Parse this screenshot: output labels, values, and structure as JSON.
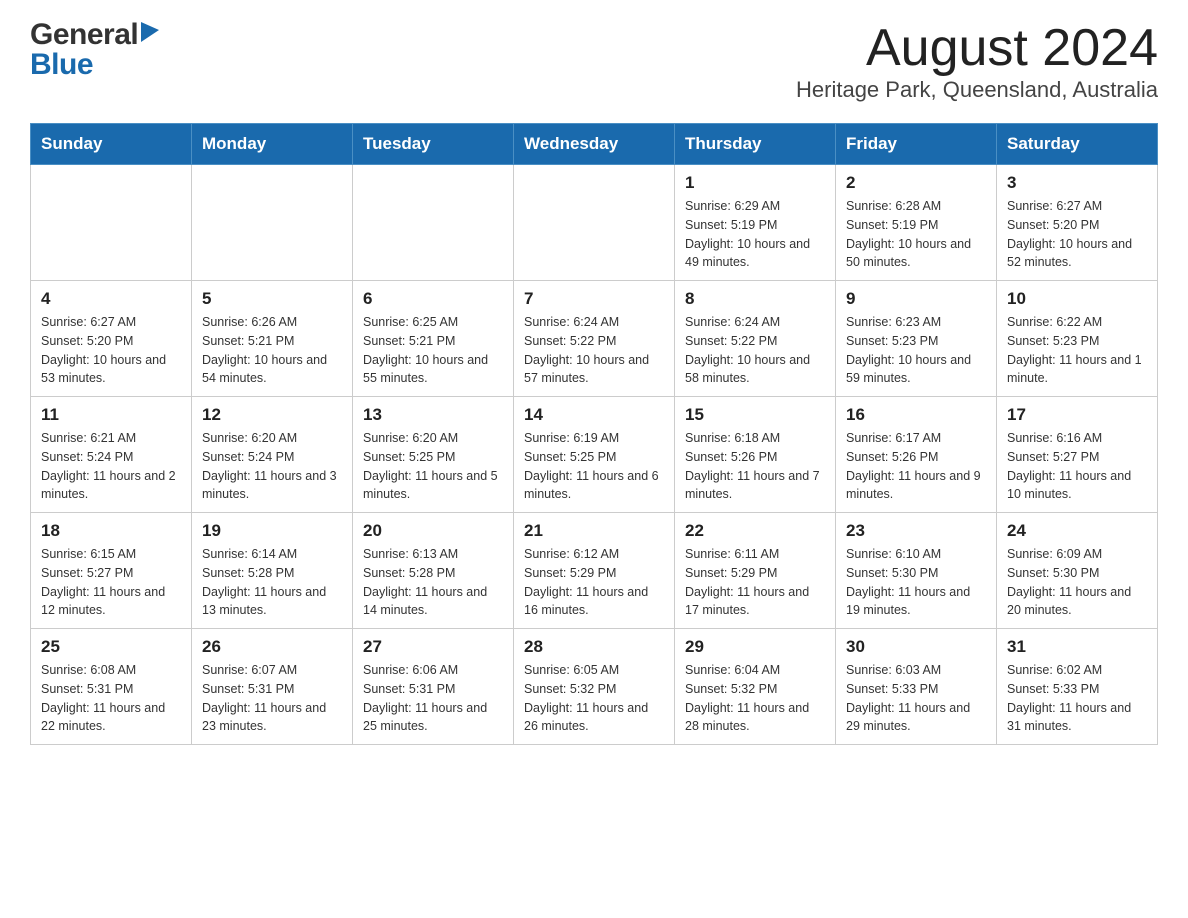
{
  "header": {
    "logo_general": "General",
    "logo_blue": "Blue",
    "month_title": "August 2024",
    "location": "Heritage Park, Queensland, Australia"
  },
  "weekdays": [
    "Sunday",
    "Monday",
    "Tuesday",
    "Wednesday",
    "Thursday",
    "Friday",
    "Saturday"
  ],
  "weeks": [
    [
      {
        "day": "",
        "info": ""
      },
      {
        "day": "",
        "info": ""
      },
      {
        "day": "",
        "info": ""
      },
      {
        "day": "",
        "info": ""
      },
      {
        "day": "1",
        "info": "Sunrise: 6:29 AM\nSunset: 5:19 PM\nDaylight: 10 hours\nand 49 minutes."
      },
      {
        "day": "2",
        "info": "Sunrise: 6:28 AM\nSunset: 5:19 PM\nDaylight: 10 hours\nand 50 minutes."
      },
      {
        "day": "3",
        "info": "Sunrise: 6:27 AM\nSunset: 5:20 PM\nDaylight: 10 hours\nand 52 minutes."
      }
    ],
    [
      {
        "day": "4",
        "info": "Sunrise: 6:27 AM\nSunset: 5:20 PM\nDaylight: 10 hours\nand 53 minutes."
      },
      {
        "day": "5",
        "info": "Sunrise: 6:26 AM\nSunset: 5:21 PM\nDaylight: 10 hours\nand 54 minutes."
      },
      {
        "day": "6",
        "info": "Sunrise: 6:25 AM\nSunset: 5:21 PM\nDaylight: 10 hours\nand 55 minutes."
      },
      {
        "day": "7",
        "info": "Sunrise: 6:24 AM\nSunset: 5:22 PM\nDaylight: 10 hours\nand 57 minutes."
      },
      {
        "day": "8",
        "info": "Sunrise: 6:24 AM\nSunset: 5:22 PM\nDaylight: 10 hours\nand 58 minutes."
      },
      {
        "day": "9",
        "info": "Sunrise: 6:23 AM\nSunset: 5:23 PM\nDaylight: 10 hours\nand 59 minutes."
      },
      {
        "day": "10",
        "info": "Sunrise: 6:22 AM\nSunset: 5:23 PM\nDaylight: 11 hours\nand 1 minute."
      }
    ],
    [
      {
        "day": "11",
        "info": "Sunrise: 6:21 AM\nSunset: 5:24 PM\nDaylight: 11 hours\nand 2 minutes."
      },
      {
        "day": "12",
        "info": "Sunrise: 6:20 AM\nSunset: 5:24 PM\nDaylight: 11 hours\nand 3 minutes."
      },
      {
        "day": "13",
        "info": "Sunrise: 6:20 AM\nSunset: 5:25 PM\nDaylight: 11 hours\nand 5 minutes."
      },
      {
        "day": "14",
        "info": "Sunrise: 6:19 AM\nSunset: 5:25 PM\nDaylight: 11 hours\nand 6 minutes."
      },
      {
        "day": "15",
        "info": "Sunrise: 6:18 AM\nSunset: 5:26 PM\nDaylight: 11 hours\nand 7 minutes."
      },
      {
        "day": "16",
        "info": "Sunrise: 6:17 AM\nSunset: 5:26 PM\nDaylight: 11 hours\nand 9 minutes."
      },
      {
        "day": "17",
        "info": "Sunrise: 6:16 AM\nSunset: 5:27 PM\nDaylight: 11 hours\nand 10 minutes."
      }
    ],
    [
      {
        "day": "18",
        "info": "Sunrise: 6:15 AM\nSunset: 5:27 PM\nDaylight: 11 hours\nand 12 minutes."
      },
      {
        "day": "19",
        "info": "Sunrise: 6:14 AM\nSunset: 5:28 PM\nDaylight: 11 hours\nand 13 minutes."
      },
      {
        "day": "20",
        "info": "Sunrise: 6:13 AM\nSunset: 5:28 PM\nDaylight: 11 hours\nand 14 minutes."
      },
      {
        "day": "21",
        "info": "Sunrise: 6:12 AM\nSunset: 5:29 PM\nDaylight: 11 hours\nand 16 minutes."
      },
      {
        "day": "22",
        "info": "Sunrise: 6:11 AM\nSunset: 5:29 PM\nDaylight: 11 hours\nand 17 minutes."
      },
      {
        "day": "23",
        "info": "Sunrise: 6:10 AM\nSunset: 5:30 PM\nDaylight: 11 hours\nand 19 minutes."
      },
      {
        "day": "24",
        "info": "Sunrise: 6:09 AM\nSunset: 5:30 PM\nDaylight: 11 hours\nand 20 minutes."
      }
    ],
    [
      {
        "day": "25",
        "info": "Sunrise: 6:08 AM\nSunset: 5:31 PM\nDaylight: 11 hours\nand 22 minutes."
      },
      {
        "day": "26",
        "info": "Sunrise: 6:07 AM\nSunset: 5:31 PM\nDaylight: 11 hours\nand 23 minutes."
      },
      {
        "day": "27",
        "info": "Sunrise: 6:06 AM\nSunset: 5:31 PM\nDaylight: 11 hours\nand 25 minutes."
      },
      {
        "day": "28",
        "info": "Sunrise: 6:05 AM\nSunset: 5:32 PM\nDaylight: 11 hours\nand 26 minutes."
      },
      {
        "day": "29",
        "info": "Sunrise: 6:04 AM\nSunset: 5:32 PM\nDaylight: 11 hours\nand 28 minutes."
      },
      {
        "day": "30",
        "info": "Sunrise: 6:03 AM\nSunset: 5:33 PM\nDaylight: 11 hours\nand 29 minutes."
      },
      {
        "day": "31",
        "info": "Sunrise: 6:02 AM\nSunset: 5:33 PM\nDaylight: 11 hours\nand 31 minutes."
      }
    ]
  ]
}
